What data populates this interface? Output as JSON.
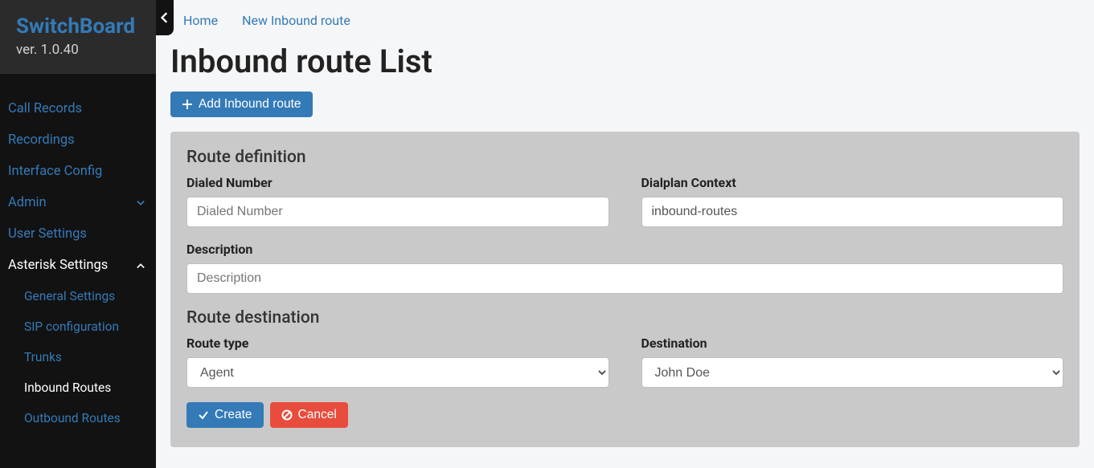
{
  "app": {
    "name": "SwitchBoard",
    "version": "ver. 1.0.40"
  },
  "nav": {
    "items": [
      {
        "label": "Call Records"
      },
      {
        "label": "Recordings"
      },
      {
        "label": "Interface Config"
      },
      {
        "label": "Admin",
        "expandable": true,
        "expanded": false
      },
      {
        "label": "User Settings"
      },
      {
        "label": "Asterisk Settings",
        "expandable": true,
        "expanded": true,
        "active": true,
        "children": [
          {
            "label": "General Settings"
          },
          {
            "label": "SIP configuration"
          },
          {
            "label": "Trunks"
          },
          {
            "label": "Inbound Routes",
            "active": true
          },
          {
            "label": "Outbound Routes"
          }
        ]
      }
    ]
  },
  "breadcrumbs": [
    "Home",
    "New Inbound route"
  ],
  "page": {
    "title": "Inbound route List",
    "add_button": "Add Inbound route"
  },
  "form": {
    "sections": {
      "definition": {
        "title": "Route definition",
        "dialed_number": {
          "label": "Dialed Number",
          "placeholder": "Dialed Number",
          "value": ""
        },
        "dialplan_context": {
          "label": "Dialplan Context",
          "value": "inbound-routes"
        },
        "description": {
          "label": "Description",
          "placeholder": "Description",
          "value": ""
        }
      },
      "destination": {
        "title": "Route destination",
        "route_type": {
          "label": "Route type",
          "value": "Agent"
        },
        "destination": {
          "label": "Destination",
          "value": "John Doe"
        }
      }
    },
    "buttons": {
      "create": "Create",
      "cancel": "Cancel"
    }
  }
}
